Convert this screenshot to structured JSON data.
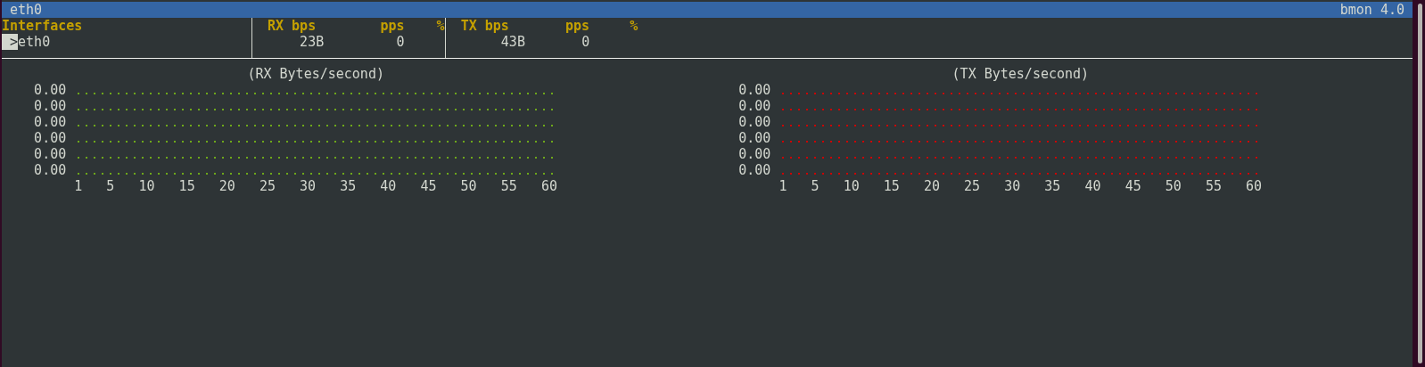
{
  "window": {
    "title": "eth0",
    "app_version": "bmon 4.0"
  },
  "table": {
    "headers": {
      "interface": "Interfaces",
      "rx_bps": "RX bps",
      "rx_pps": "pps",
      "rx_pct": "%",
      "tx_bps": "TX bps",
      "tx_pps": "pps",
      "tx_pct": "%"
    },
    "rows": [
      {
        "cursor": ">",
        "name": "eth0",
        "selected": true,
        "rx_bps": "23B",
        "rx_pps": "0",
        "tx_bps": "43B",
        "tx_pps": "0"
      }
    ]
  },
  "graphs": [
    {
      "title": "(RX Bytes/second)",
      "color": "#6ea81a",
      "y_labels": [
        "0.00",
        "0.00",
        "0.00",
        "0.00",
        "0.00",
        "0.00"
      ],
      "x_labels": [
        "1",
        "5",
        "10",
        "15",
        "20",
        "25",
        "30",
        "35",
        "40",
        "45",
        "50",
        "55",
        "60"
      ]
    },
    {
      "title": "(TX Bytes/second)",
      "color": "#cc0000",
      "y_labels": [
        "0.00",
        "0.00",
        "0.00",
        "0.00",
        "0.00",
        "0.00"
      ],
      "x_labels": [
        "1",
        "5",
        "10",
        "15",
        "20",
        "25",
        "30",
        "35",
        "40",
        "45",
        "50",
        "55",
        "60"
      ]
    }
  ]
}
